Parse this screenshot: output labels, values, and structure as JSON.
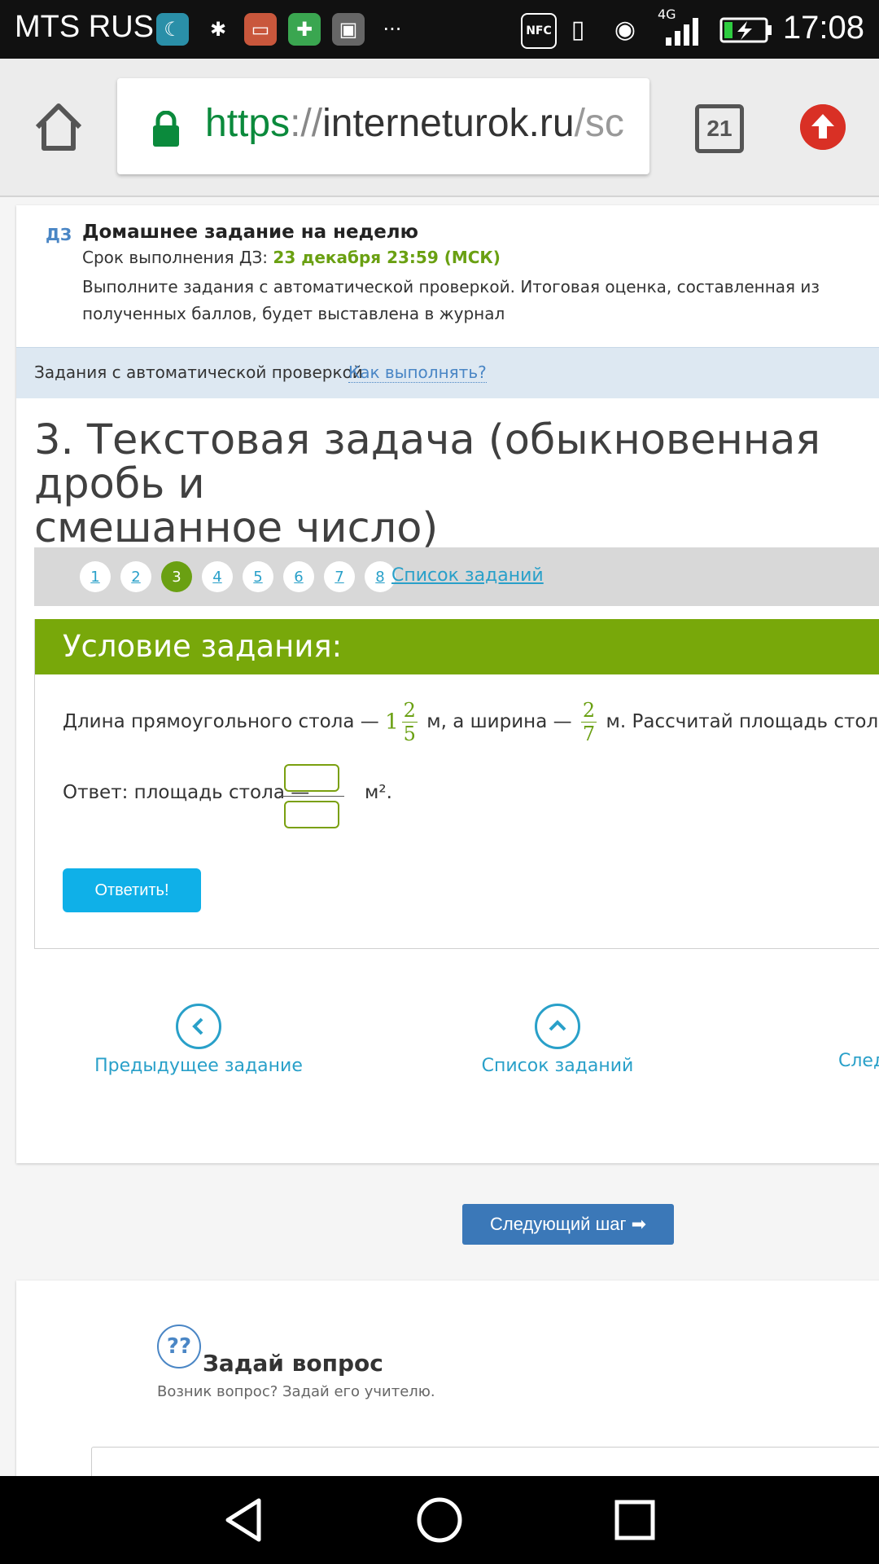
{
  "status_bar": {
    "carrier": "MTS RUS",
    "time": "17:08",
    "network": "4G",
    "icons": [
      "moon-app-icon",
      "spider-icon",
      "inbox-app-icon",
      "puzzle-app-icon",
      "gallery-icon",
      "more-dots-icon",
      "nfc-icon",
      "vibrate-icon",
      "eye-icon",
      "signal-icon",
      "battery-charging-icon"
    ]
  },
  "browser": {
    "url_scheme": "https",
    "url_sep": "://",
    "url_host": "interneturok.ru",
    "url_path": "/sc",
    "tab_count": "21"
  },
  "homework": {
    "tag": "ДЗ",
    "title": "Домашнее задание на неделю",
    "deadline_label": "Срок выполнения ДЗ: ",
    "deadline_value": "23 декабря 23:59 (МСК)",
    "description": "Выполните задания с автоматической проверкой. Итоговая оценка, составленная из полученных баллов, будет выставлена в журнал"
  },
  "auto_bar": {
    "label": "Задания с автоматической проверкой",
    "how_link": "Как выполнять?"
  },
  "task": {
    "title": "3. Текстовая задача (обыкновенная дробь и\nсмешанное число)"
  },
  "pager": {
    "pages": [
      "1",
      "2",
      "3",
      "4",
      "5",
      "6",
      "7",
      "8"
    ],
    "active_index": 2,
    "list_link": "Список заданий"
  },
  "condition": {
    "header": "Условие задания:",
    "text_part1": "Длина прямоугольного стола —",
    "len_whole": "1",
    "len_num": "2",
    "len_den": "5",
    "text_part2": "м, а ширина —",
    "width_num": "2",
    "width_den": "7",
    "text_part3": "м. Рассчитай площадь стола.",
    "answer_label": "Ответ: площадь стола —",
    "answer_unit": "м².",
    "submit_label": "Ответить!"
  },
  "bottom_nav": {
    "prev_label": "Предыдущее задание",
    "list_label": "Список заданий",
    "next_label": "Следующее задание"
  },
  "next_step_label": "Следующий шаг ➡",
  "ask": {
    "icon_text": "??",
    "title": "Задай вопрос",
    "subtitle": "Возник вопрос? Задай его учителю."
  },
  "colors": {
    "green": "#78a80a",
    "link_blue": "#29a0c9",
    "button_cyan": "#0fb0e8",
    "next_step_blue": "#3b78b8"
  }
}
